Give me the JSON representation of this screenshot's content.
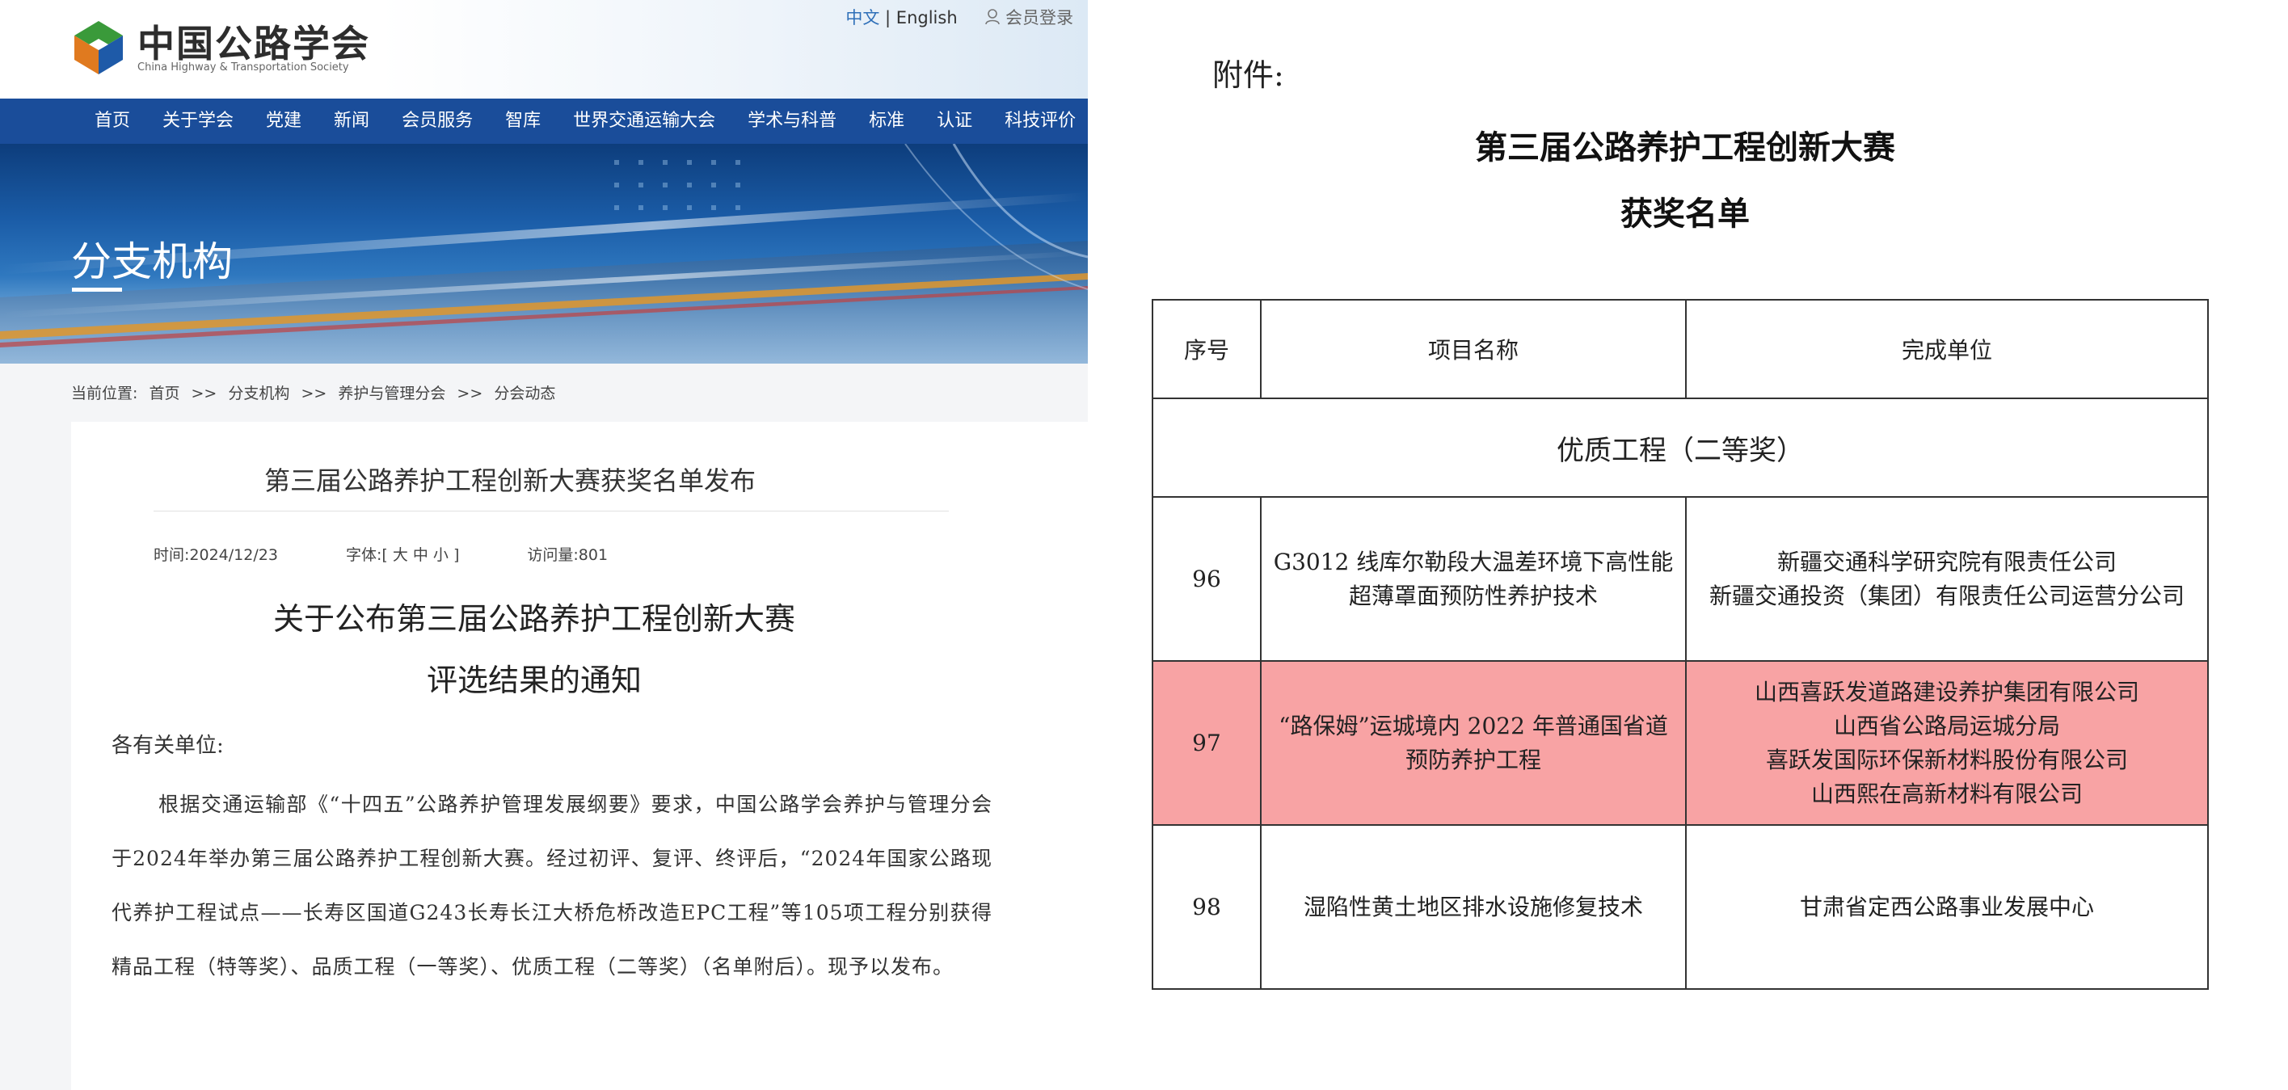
{
  "site": {
    "logo_cn": "中国公路学会",
    "logo_en": "China Highway & Transportation Society",
    "lang_cn": "中文",
    "lang_sep": "|",
    "lang_en": "English",
    "login": "会员登录"
  },
  "nav": [
    "首页",
    "关于学会",
    "党建",
    "新闻",
    "会员服务",
    "智库",
    "世界交通运输大会",
    "学术与科普",
    "标准",
    "认证",
    "科技评价"
  ],
  "banner": {
    "title": "分支机构"
  },
  "breadcrumb": {
    "label": "当前位置:",
    "items": [
      "首页",
      "分支机构",
      "养护与管理分会",
      "分会动态"
    ],
    "sep": ">>"
  },
  "article": {
    "title": "第三届公路养护工程创新大赛获奖名单发布",
    "time": "时间:2024/12/23",
    "font_size": "字体:[ 大 中 小 ]",
    "views": "访问量:801",
    "notice_title_line1": "关于公布第三届公路养护工程创新大赛",
    "notice_title_line2": "评选结果的通知",
    "salutation": "各有关单位:",
    "body": "根据交通运输部《“十四五”公路养护管理发展纲要》要求，中国公路学会养护与管理分会于2024年举办第三届公路养护工程创新大赛。经过初评、复评、终评后，“2024年国家公路现代养护工程试点——长寿区国道G243长寿长江大桥危桥改造EPC工程”等105项工程分别获得精品工程（特等奖）、品质工程（一等奖）、优质工程（二等奖）（名单附后）。现予以发布。"
  },
  "document": {
    "attachment_label": "附件:",
    "title_line1": "第三届公路养护工程创新大赛",
    "title_line2": "获奖名单",
    "table": {
      "headers": [
        "序号",
        "项目名称",
        "完成单位"
      ],
      "category": "优质工程（二等奖）",
      "rows": [
        {
          "no": "96",
          "project": "G3012 线库尔勒段大温差环境下高性能超薄罩面预防性养护技术",
          "units": [
            "新疆交通科学研究院有限责任公司",
            "新疆交通投资（集团）有限责任公司运营分公司"
          ]
        },
        {
          "no": "97",
          "project": "“路保姆”运城境内 2022 年普通国省道预防养护工程",
          "units": [
            "山西喜跃发道路建设养护集团有限公司",
            "山西省公路局运城分局",
            "喜跃发国际环保新材料股份有限公司",
            "山西熙在高新材料有限公司"
          ],
          "highlighted": true
        },
        {
          "no": "98",
          "project": "湿陷性黄土地区排水设施修复技术",
          "units": [
            "甘肃省定西公路事业发展中心"
          ]
        }
      ]
    }
  },
  "colors": {
    "nav_bg": "#1a4d9a",
    "highlight": "#f8a3a4",
    "link": "#2e6fb8"
  }
}
